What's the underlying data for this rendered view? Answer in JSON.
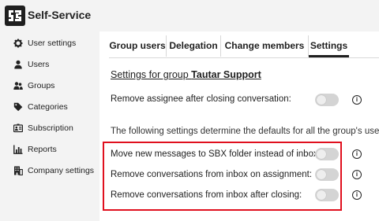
{
  "app": {
    "title": "Self-Service"
  },
  "sidebar": {
    "items": [
      {
        "label": "User settings",
        "icon": "gear-icon"
      },
      {
        "label": "Users",
        "icon": "user-icon"
      },
      {
        "label": "Groups",
        "icon": "groups-icon"
      },
      {
        "label": "Categories",
        "icon": "tag-icon"
      },
      {
        "label": "Subscription",
        "icon": "id-card-icon"
      },
      {
        "label": "Reports",
        "icon": "bar-chart-icon"
      },
      {
        "label": "Company settings",
        "icon": "building-icon"
      }
    ]
  },
  "tabs": [
    {
      "label": "Group users",
      "active": false
    },
    {
      "label": "Delegation",
      "active": false
    },
    {
      "label": "Change members",
      "active": false
    },
    {
      "label": "Settings",
      "active": true
    }
  ],
  "settings": {
    "heading_prefix": "Settings for group ",
    "group_name": "Tautar Support",
    "remove_assignee": {
      "label": "Remove assignee after closing conversation:",
      "enabled": false
    },
    "defaults_note": "The following settings determine the defaults for all the group's users.",
    "defaults": [
      {
        "label": "Move new messages to SBX folder instead of inbox:",
        "enabled": false
      },
      {
        "label": "Remove conversations from inbox on assignment:",
        "enabled": false
      },
      {
        "label": "Remove conversations from inbox after closing:",
        "enabled": false
      }
    ]
  },
  "colors": {
    "highlight": "#e0101e",
    "toggle_off": "#d4d4d4",
    "sidebar_bg": "#f3f3f3"
  }
}
